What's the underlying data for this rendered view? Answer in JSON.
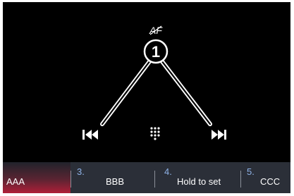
{
  "display": {
    "af_indicator": "AF",
    "preset_number": "1",
    "controls": {
      "previous_icon": "skip-previous-icon",
      "keypad_icon": "keypad-icon",
      "next_icon": "skip-next-icon"
    }
  },
  "presets": [
    {
      "number": "",
      "label": "AAA",
      "active": true
    },
    {
      "number": "3.",
      "label": "BBB",
      "active": false
    },
    {
      "number": "4.",
      "label": "Hold to set",
      "active": false
    },
    {
      "number": "5.",
      "label": "CCC",
      "active": false
    }
  ],
  "colors": {
    "background": "#000000",
    "preset_bar": "#2b2f38",
    "active_preset_gradient": "#c0253d",
    "preset_number": "#8fb3e8",
    "icon": "#ffffff"
  }
}
